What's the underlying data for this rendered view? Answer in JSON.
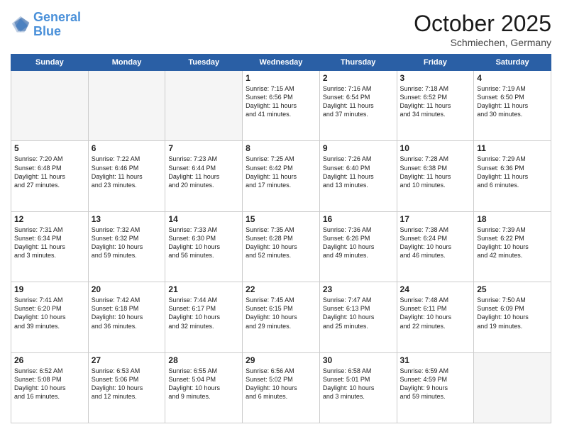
{
  "header": {
    "logo_line1": "General",
    "logo_line2": "Blue",
    "month_title": "October 2025",
    "location": "Schmiechen, Germany"
  },
  "weekdays": [
    "Sunday",
    "Monday",
    "Tuesday",
    "Wednesday",
    "Thursday",
    "Friday",
    "Saturday"
  ],
  "weeks": [
    [
      {
        "day": "",
        "info": ""
      },
      {
        "day": "",
        "info": ""
      },
      {
        "day": "",
        "info": ""
      },
      {
        "day": "1",
        "info": "Sunrise: 7:15 AM\nSunset: 6:56 PM\nDaylight: 11 hours\nand 41 minutes."
      },
      {
        "day": "2",
        "info": "Sunrise: 7:16 AM\nSunset: 6:54 PM\nDaylight: 11 hours\nand 37 minutes."
      },
      {
        "day": "3",
        "info": "Sunrise: 7:18 AM\nSunset: 6:52 PM\nDaylight: 11 hours\nand 34 minutes."
      },
      {
        "day": "4",
        "info": "Sunrise: 7:19 AM\nSunset: 6:50 PM\nDaylight: 11 hours\nand 30 minutes."
      }
    ],
    [
      {
        "day": "5",
        "info": "Sunrise: 7:20 AM\nSunset: 6:48 PM\nDaylight: 11 hours\nand 27 minutes."
      },
      {
        "day": "6",
        "info": "Sunrise: 7:22 AM\nSunset: 6:46 PM\nDaylight: 11 hours\nand 23 minutes."
      },
      {
        "day": "7",
        "info": "Sunrise: 7:23 AM\nSunset: 6:44 PM\nDaylight: 11 hours\nand 20 minutes."
      },
      {
        "day": "8",
        "info": "Sunrise: 7:25 AM\nSunset: 6:42 PM\nDaylight: 11 hours\nand 17 minutes."
      },
      {
        "day": "9",
        "info": "Sunrise: 7:26 AM\nSunset: 6:40 PM\nDaylight: 11 hours\nand 13 minutes."
      },
      {
        "day": "10",
        "info": "Sunrise: 7:28 AM\nSunset: 6:38 PM\nDaylight: 11 hours\nand 10 minutes."
      },
      {
        "day": "11",
        "info": "Sunrise: 7:29 AM\nSunset: 6:36 PM\nDaylight: 11 hours\nand 6 minutes."
      }
    ],
    [
      {
        "day": "12",
        "info": "Sunrise: 7:31 AM\nSunset: 6:34 PM\nDaylight: 11 hours\nand 3 minutes."
      },
      {
        "day": "13",
        "info": "Sunrise: 7:32 AM\nSunset: 6:32 PM\nDaylight: 10 hours\nand 59 minutes."
      },
      {
        "day": "14",
        "info": "Sunrise: 7:33 AM\nSunset: 6:30 PM\nDaylight: 10 hours\nand 56 minutes."
      },
      {
        "day": "15",
        "info": "Sunrise: 7:35 AM\nSunset: 6:28 PM\nDaylight: 10 hours\nand 52 minutes."
      },
      {
        "day": "16",
        "info": "Sunrise: 7:36 AM\nSunset: 6:26 PM\nDaylight: 10 hours\nand 49 minutes."
      },
      {
        "day": "17",
        "info": "Sunrise: 7:38 AM\nSunset: 6:24 PM\nDaylight: 10 hours\nand 46 minutes."
      },
      {
        "day": "18",
        "info": "Sunrise: 7:39 AM\nSunset: 6:22 PM\nDaylight: 10 hours\nand 42 minutes."
      }
    ],
    [
      {
        "day": "19",
        "info": "Sunrise: 7:41 AM\nSunset: 6:20 PM\nDaylight: 10 hours\nand 39 minutes."
      },
      {
        "day": "20",
        "info": "Sunrise: 7:42 AM\nSunset: 6:18 PM\nDaylight: 10 hours\nand 36 minutes."
      },
      {
        "day": "21",
        "info": "Sunrise: 7:44 AM\nSunset: 6:17 PM\nDaylight: 10 hours\nand 32 minutes."
      },
      {
        "day": "22",
        "info": "Sunrise: 7:45 AM\nSunset: 6:15 PM\nDaylight: 10 hours\nand 29 minutes."
      },
      {
        "day": "23",
        "info": "Sunrise: 7:47 AM\nSunset: 6:13 PM\nDaylight: 10 hours\nand 25 minutes."
      },
      {
        "day": "24",
        "info": "Sunrise: 7:48 AM\nSunset: 6:11 PM\nDaylight: 10 hours\nand 22 minutes."
      },
      {
        "day": "25",
        "info": "Sunrise: 7:50 AM\nSunset: 6:09 PM\nDaylight: 10 hours\nand 19 minutes."
      }
    ],
    [
      {
        "day": "26",
        "info": "Sunrise: 6:52 AM\nSunset: 5:08 PM\nDaylight: 10 hours\nand 16 minutes."
      },
      {
        "day": "27",
        "info": "Sunrise: 6:53 AM\nSunset: 5:06 PM\nDaylight: 10 hours\nand 12 minutes."
      },
      {
        "day": "28",
        "info": "Sunrise: 6:55 AM\nSunset: 5:04 PM\nDaylight: 10 hours\nand 9 minutes."
      },
      {
        "day": "29",
        "info": "Sunrise: 6:56 AM\nSunset: 5:02 PM\nDaylight: 10 hours\nand 6 minutes."
      },
      {
        "day": "30",
        "info": "Sunrise: 6:58 AM\nSunset: 5:01 PM\nDaylight: 10 hours\nand 3 minutes."
      },
      {
        "day": "31",
        "info": "Sunrise: 6:59 AM\nSunset: 4:59 PM\nDaylight: 9 hours\nand 59 minutes."
      },
      {
        "day": "",
        "info": ""
      }
    ]
  ]
}
